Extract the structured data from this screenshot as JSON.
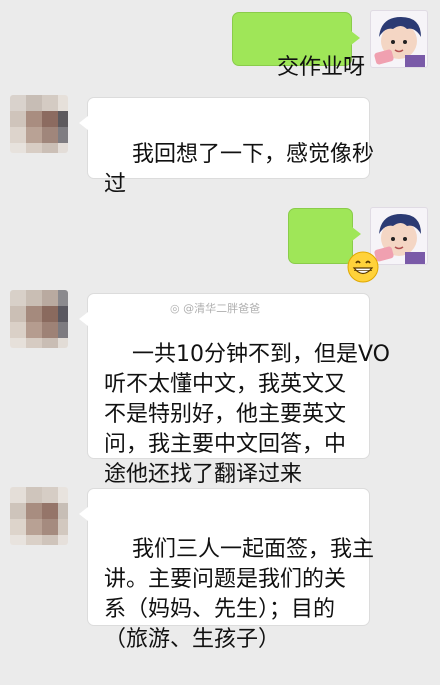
{
  "messages": [
    {
      "sender": "self",
      "type": "text",
      "text": "交作业呀"
    },
    {
      "sender": "other",
      "type": "text",
      "text": "我回想了一下，感觉像秒\n过"
    },
    {
      "sender": "self",
      "type": "emoji",
      "emoji": "😁"
    },
    {
      "sender": "other",
      "type": "text",
      "text": "一共10分钟不到，但是VO\n听不太懂中文，我英文又\n不是特别好，他主要英文\n问，我主要中文回答，中\n途他还找了翻译过来"
    },
    {
      "sender": "other",
      "type": "text",
      "text": "我们三人一起面签，我主\n讲。主要问题是我们的关\n系（妈妈、先生）；目的\n（旅游、生孩子）"
    }
  ],
  "watermark": "@清华二胖爸爸",
  "colors": {
    "background": "#ebebeb",
    "outgoing_bubble": "#9fe658",
    "incoming_bubble": "#ffffff"
  },
  "icons": {
    "self_avatar": "cartoon-boy-avatar-icon",
    "other_avatar": "pixelated-avatar-icon"
  }
}
